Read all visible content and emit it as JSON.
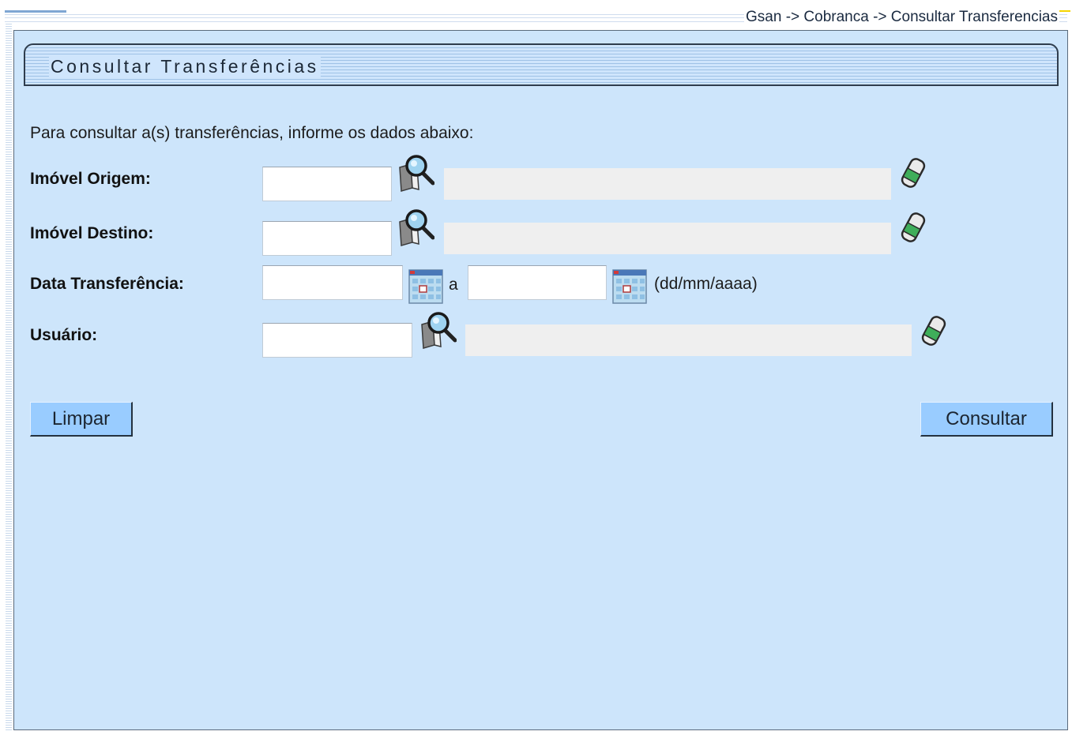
{
  "breadcrumb": "Gsan -> Cobranca -> Consultar Transferencias",
  "title": "Consultar Transferências",
  "intro": "Para consultar a(s) transferências, informe os dados abaixo:",
  "fields": {
    "imovel_origem": {
      "label": "Imóvel Origem:",
      "value": "",
      "description": ""
    },
    "imovel_destino": {
      "label": "Imóvel Destino:",
      "value": "",
      "description": ""
    },
    "data_transferencia": {
      "label": "Data Transferência:",
      "start": "",
      "end": "",
      "separator": "a",
      "format_hint": "(dd/mm/aaaa)"
    },
    "usuario": {
      "label": "Usuário:",
      "value": "",
      "description": ""
    }
  },
  "buttons": {
    "clear": "Limpar",
    "search": "Consultar"
  },
  "icons": {
    "lookup": "magnifier-icon",
    "clear_field": "eraser-icon",
    "calendar": "calendar-icon"
  },
  "colors": {
    "panel_bg": "#cde5fb",
    "button_bg": "#99ccff",
    "accent_yellow": "#f5d400"
  }
}
